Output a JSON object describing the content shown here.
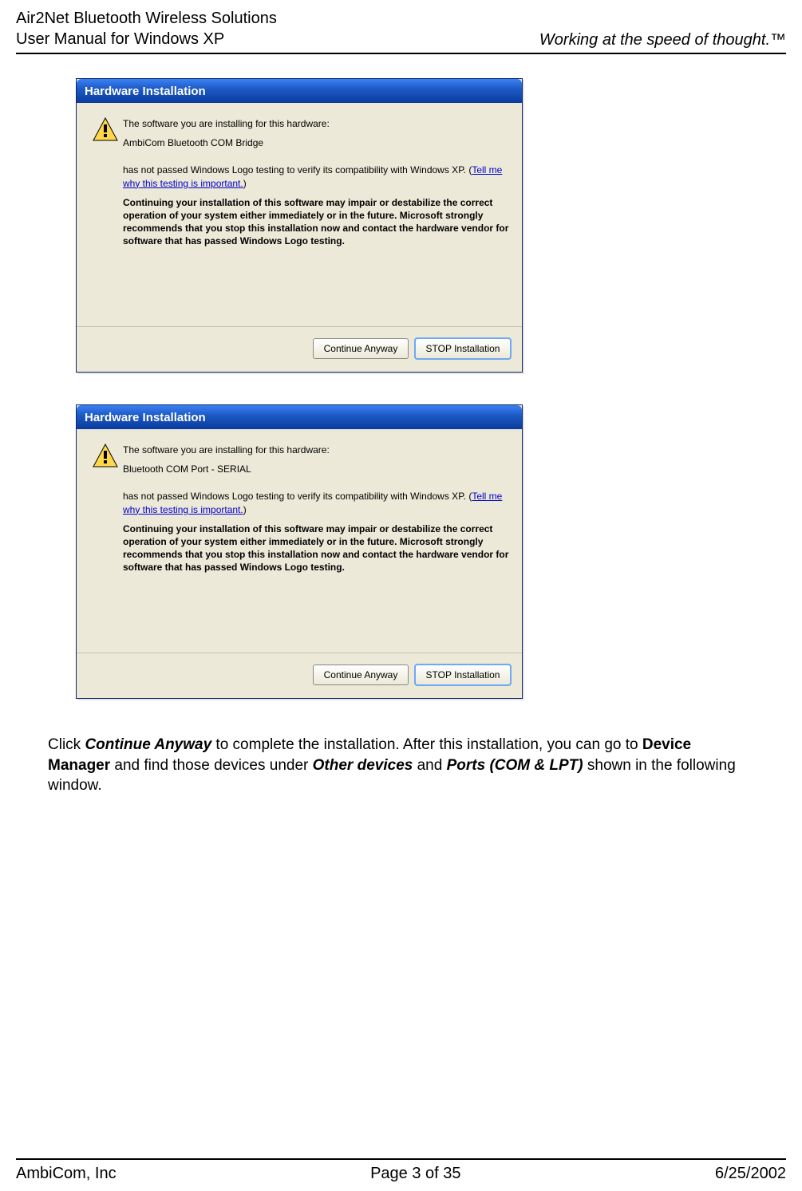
{
  "header": {
    "line1": "Air2Net Bluetooth Wireless Solutions",
    "line2": "User Manual for Windows XP",
    "right": "Working at the speed of thought.™"
  },
  "dialog1": {
    "title": "Hardware Installation",
    "intro": "The software you are installing for this hardware:",
    "device": "AmbiCom Bluetooth COM Bridge",
    "notpassed_pre": "has not passed Windows Logo testing to verify its compatibility with Windows XP. (",
    "link": "Tell me why this testing is important.",
    "notpassed_post": ")",
    "warning": "Continuing your installation of this software may impair or destabilize the correct operation of your system either immediately or in the future. Microsoft strongly recommends that you stop this installation now and contact the hardware vendor for software that has passed Windows Logo testing.",
    "btn_continue": "Continue Anyway",
    "btn_stop": "STOP Installation"
  },
  "dialog2": {
    "title": "Hardware Installation",
    "intro": "The software you are installing for this hardware:",
    "device": "Bluetooth COM Port - SERIAL",
    "notpassed_pre": "has not passed Windows Logo testing to verify its compatibility with Windows XP. (",
    "link": "Tell me why this testing is important.",
    "notpassed_post": ")",
    "warning": "Continuing your installation of this software may impair or destabilize the correct operation of your system either immediately or in the future. Microsoft strongly recommends that you stop this installation now and contact the hardware vendor for software that has passed Windows Logo testing.",
    "btn_continue": "Continue Anyway",
    "btn_stop": "STOP Installation"
  },
  "bodytext": {
    "pre": "Click ",
    "b1": "Continue Anyway",
    "mid1": " to complete the installation. After this installation, you can go to ",
    "b2": "Device Manager",
    "mid2": " and find those devices under ",
    "b3": "Other devices",
    "mid3": " and ",
    "b4": "Ports (COM & LPT)",
    "post": " shown in the following window."
  },
  "footer": {
    "left": "AmbiCom, Inc",
    "center": "Page 3 of 35",
    "right": "6/25/2002"
  }
}
